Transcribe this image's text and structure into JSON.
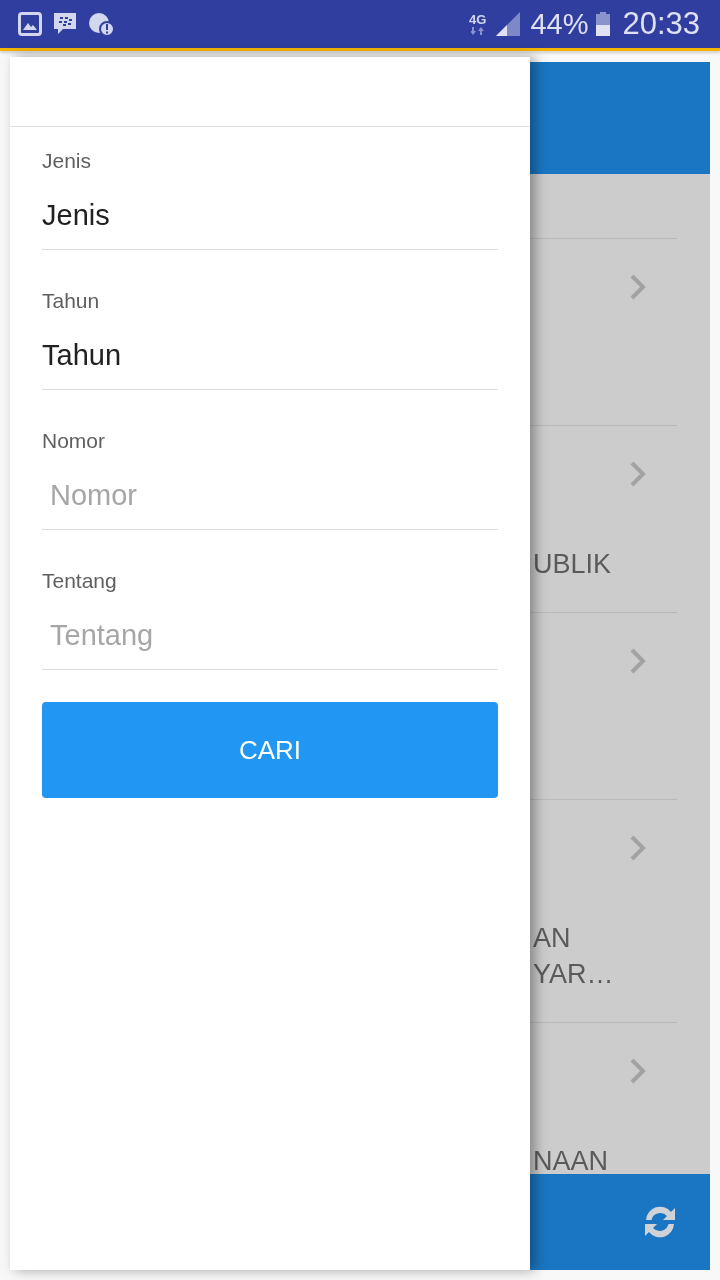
{
  "status_bar": {
    "network": "4G",
    "battery": "44%",
    "time": "20:33"
  },
  "drawer": {
    "fields": [
      {
        "kind": "select",
        "label": "Jenis",
        "value": "Jenis"
      },
      {
        "kind": "select",
        "label": "Tahun",
        "value": "Tahun"
      },
      {
        "kind": "text",
        "label": "Nomor",
        "placeholder": "Nomor"
      },
      {
        "kind": "text",
        "label": "Tentang",
        "placeholder": "Tentang"
      }
    ],
    "search_button": "CARI"
  },
  "background_list": {
    "rows": [
      {},
      {
        "lines": [
          "UBLIK"
        ]
      },
      {},
      {
        "lines": [
          "AN",
          "YAR…"
        ]
      },
      {
        "lines": [
          "NAAN"
        ]
      }
    ]
  }
}
